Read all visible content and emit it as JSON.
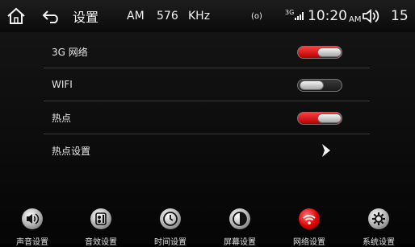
{
  "status": {
    "title": "设置",
    "band": "AM",
    "frequency": "576",
    "unit": "KHz",
    "radio_indicator": "(o)",
    "network": "3G",
    "time": "10:20",
    "ampm": "AM",
    "volume": "15"
  },
  "settings": [
    {
      "label": "3G 网络",
      "type": "toggle",
      "state": "on"
    },
    {
      "label": "WIFI",
      "type": "toggle",
      "state": "off"
    },
    {
      "label": "热点",
      "type": "toggle",
      "state": "on"
    },
    {
      "label": "热点设置",
      "type": "link"
    }
  ],
  "bottom_nav": [
    {
      "label": "声音设置",
      "icon": "speaker-icon"
    },
    {
      "label": "音效设置",
      "icon": "equalizer-icon"
    },
    {
      "label": "时间设置",
      "icon": "clock-icon"
    },
    {
      "label": "屏幕设置",
      "icon": "contrast-icon"
    },
    {
      "label": "网络设置",
      "icon": "wifi-icon",
      "active": true
    },
    {
      "label": "系统设置",
      "icon": "gear-icon"
    }
  ],
  "colors": {
    "accent": "#e00000",
    "background": "#0c0c0c",
    "text": "#e8e8e8"
  }
}
